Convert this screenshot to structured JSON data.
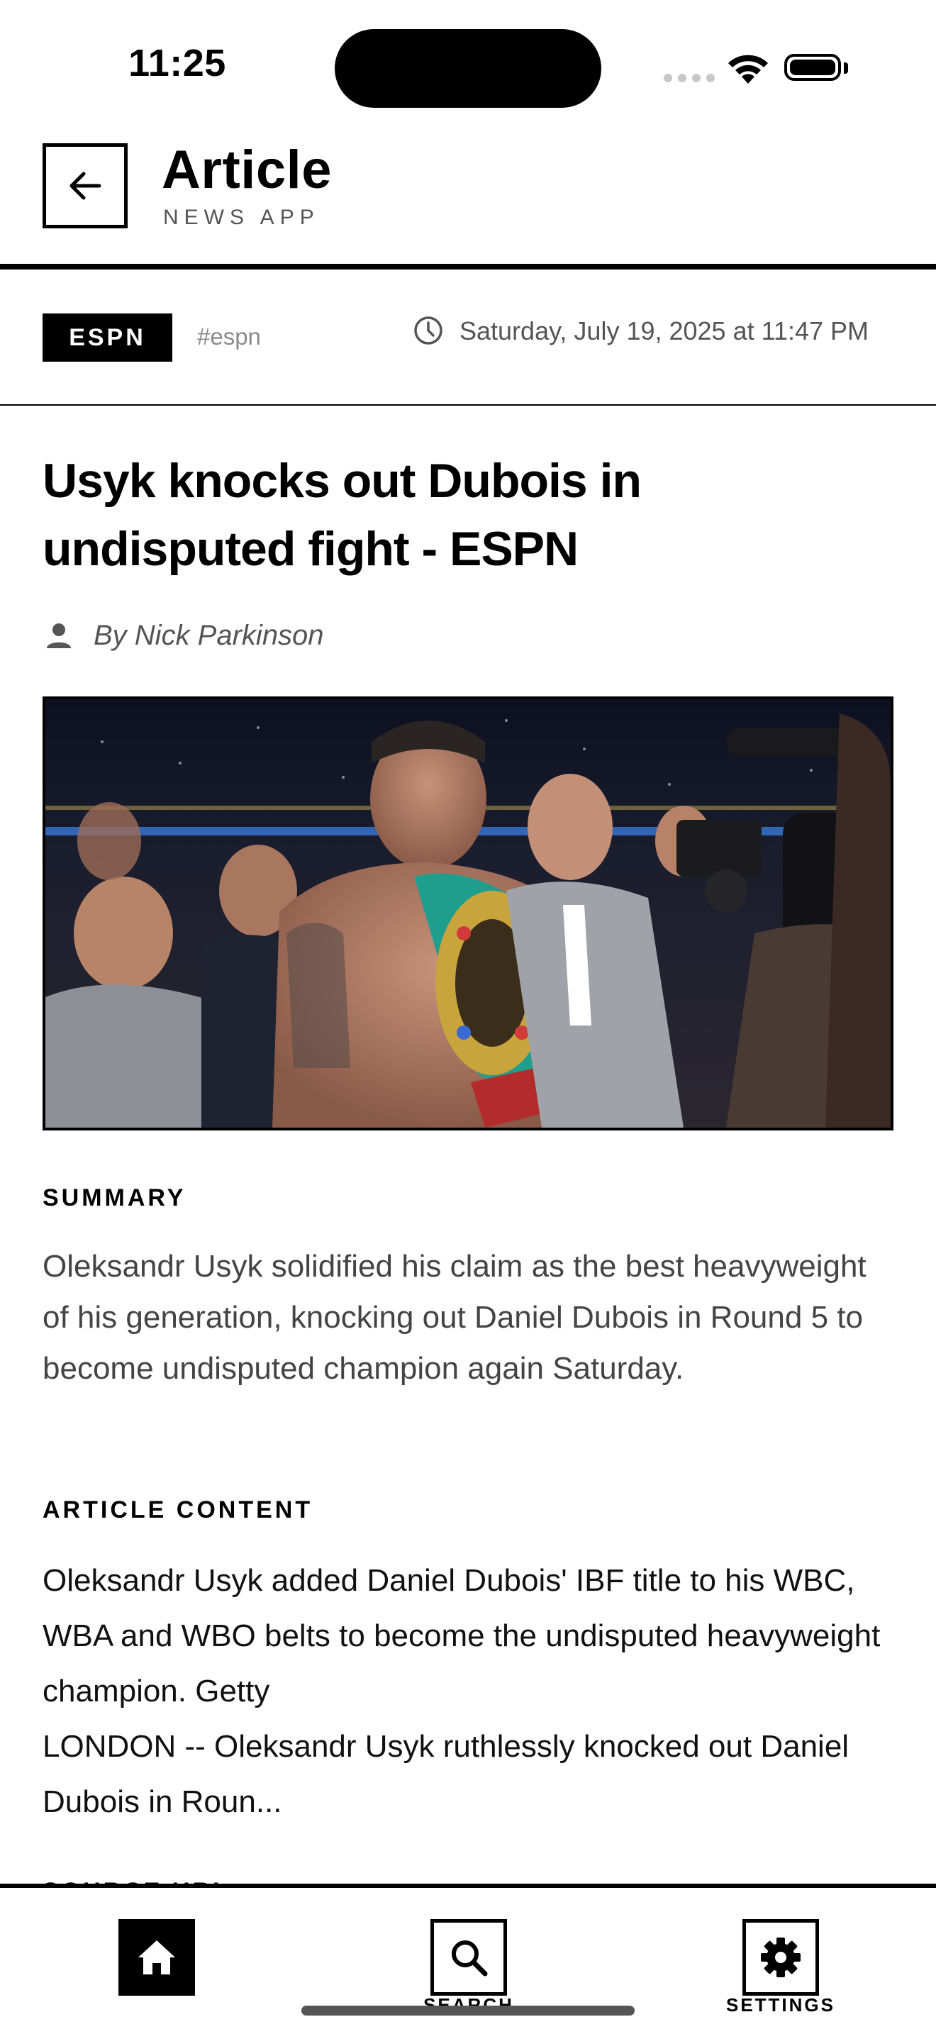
{
  "status_bar": {
    "time": "11:25"
  },
  "header": {
    "title": "Article",
    "subtitle": "NEWS APP",
    "back_icon": "arrow-left-icon"
  },
  "meta": {
    "source": "ESPN",
    "hashtag": "#espn",
    "date": "Saturday, July 19, 2025 at 11:47 PM",
    "clock_icon": "clock-icon"
  },
  "article": {
    "headline": "Usyk knocks out Dubois in undisputed fight - ESPN",
    "author": "By Nick Parkinson",
    "author_icon": "person-icon",
    "image": "boxer-with-championship-belt-photo",
    "summary_label": "SUMMARY",
    "summary": "Oleksandr Usyk solidified his claim as the best heavyweight of his generation, knocking out Daniel Dubois in Round 5 to become undisputed champion again Saturday.",
    "content_label": "ARTICLE CONTENT",
    "content": "Oleksandr Usyk added Daniel Dubois' IBF title to his WBC, WBA and WBO belts to become the undisputed heavyweight champion. Getty\nLONDON -- Oleksandr Usyk ruthlessly knocked out Daniel Dubois in Roun...",
    "next_section_label": "SOURCE URL"
  },
  "bottom_nav": {
    "items": [
      {
        "label": "",
        "icon": "home-icon",
        "active": true
      },
      {
        "label": "SEARCH",
        "icon": "search-icon",
        "active": false
      },
      {
        "label": "SETTINGS",
        "icon": "gear-icon",
        "active": false
      }
    ]
  },
  "colors": {
    "accent": "#000000",
    "muted_text": "#555555",
    "hashtag": "#8a8a8a"
  }
}
